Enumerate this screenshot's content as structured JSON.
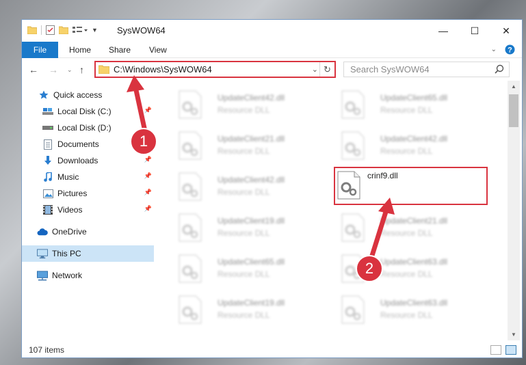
{
  "window": {
    "title": "SysWOW64",
    "controls": {
      "minimize": "—",
      "maximize": "☐",
      "close": "✕"
    }
  },
  "ribbon": {
    "file_tab": "File",
    "tabs": [
      "Home",
      "Share",
      "View"
    ]
  },
  "navigation": {
    "address_path": "C:\\Windows\\SysWOW64",
    "search_placeholder": "Search SysWOW64"
  },
  "sidebar": {
    "items": [
      {
        "label": "Quick access",
        "icon": "star-icon",
        "pinned": false
      },
      {
        "label": "Local Disk (C:)",
        "icon": "drive-icon",
        "pinned": true
      },
      {
        "label": "Local Disk (D:)",
        "icon": "drive-icon",
        "pinned": false
      },
      {
        "label": "Documents",
        "icon": "documents-icon",
        "pinned": true
      },
      {
        "label": "Downloads",
        "icon": "download-icon",
        "pinned": true
      },
      {
        "label": "Music",
        "icon": "music-icon",
        "pinned": true
      },
      {
        "label": "Pictures",
        "icon": "pictures-icon",
        "pinned": true
      },
      {
        "label": "Videos",
        "icon": "videos-icon",
        "pinned": true
      },
      {
        "label": "OneDrive",
        "icon": "cloud-icon",
        "pinned": false
      },
      {
        "label": "This PC",
        "icon": "computer-icon",
        "pinned": false,
        "selected": true
      },
      {
        "label": "Network",
        "icon": "network-icon",
        "pinned": false
      }
    ]
  },
  "files": [
    {
      "name": "UpdateClient42.dll",
      "type": "Resource DLL"
    },
    {
      "name": "UpdateClient65.dll",
      "type": "Resource DLL"
    },
    {
      "name": "UpdateClient21.dll",
      "type": "Resource DLL"
    },
    {
      "name": "UpdateClient42.dll",
      "type": "Resource DLL"
    },
    {
      "name": "UpdateClient42.dll",
      "type": "Resource DLL"
    },
    {
      "name": "crinf9.dll",
      "type": "",
      "highlighted": true
    },
    {
      "name": "UpdateClient19.dll",
      "type": "Resource DLL"
    },
    {
      "name": "UpdateClient21.dll",
      "type": "Resource DLL"
    },
    {
      "name": "UpdateClient65.dll",
      "type": "Resource DLL"
    },
    {
      "name": "UpdateClient63.dll",
      "type": "Resource DLL"
    },
    {
      "name": "UpdateClient19.dll",
      "type": "Resource DLL"
    },
    {
      "name": "UpdateClient63.dll",
      "type": "Resource DLL"
    }
  ],
  "status": {
    "item_count": "107 items"
  },
  "callouts": [
    "1",
    "2"
  ],
  "colors": {
    "highlight": "#d9333f",
    "accent": "#1979ca"
  }
}
